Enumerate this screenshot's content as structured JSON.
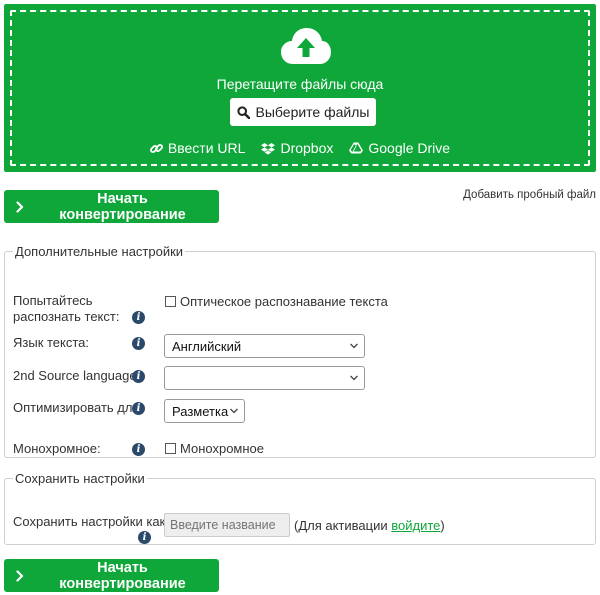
{
  "dropzone": {
    "upload_icon": "cloud-upload-icon",
    "drop_text": "Перетащите файлы сюда",
    "choose_button": "Выберите файлы",
    "choose_icon": "search-icon",
    "sources": [
      {
        "label": "Ввести URL",
        "icon": "link-icon"
      },
      {
        "label": "Dropbox",
        "icon": "dropbox-icon"
      },
      {
        "label": "Google Drive",
        "icon": "google-drive-icon"
      }
    ]
  },
  "actions": {
    "start_button": "Начать конвертирование",
    "start_icon": "chevron-right-icon",
    "sample_link": "Добавить пробный файл"
  },
  "advanced": {
    "legend": "Дополнительные настройки",
    "ocr_label": "Попытайтесь распознать текст:",
    "ocr_option": "Оптическое распознавание текста",
    "language_label": "Язык текста:",
    "language_value": "Английский",
    "source_language_label": "2nd Source language:",
    "source_language_value": "",
    "optimize_label": "Оптимизировать для:",
    "optimize_value": "Разметка",
    "mono_label": "Монохромное:",
    "mono_option": "Монохромное",
    "info_glyph": "i"
  },
  "save": {
    "legend": "Сохранить настройки",
    "label": "Сохранить настройки как:",
    "placeholder": "Введите название",
    "note_before": "(Для активации ",
    "note_link": "войдите",
    "note_after": ")"
  },
  "colors": {
    "brand_green": "#0fa739",
    "info_blue": "#2b4a6b"
  }
}
